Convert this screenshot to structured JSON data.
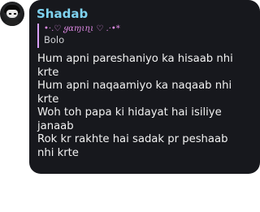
{
  "message": {
    "sender": "Shadab",
    "reply": {
      "author": "•·.♡ ყαɱιɳι ♡ .·•*",
      "text": "Bolo"
    },
    "lines": [
      "Hum apni pareshaniyo ka hisaab nhi",
      "krte",
      "Hum apni naqaamiyo ka naqaab nhi",
      "krte",
      "Woh toh papa ki hidayat hai isiliye",
      "janaab",
      "Rok kr rakhte hai sadak pr peshaab",
      "nhi krte"
    ]
  },
  "colors": {
    "bubble_background": "#17181d",
    "sender_name": "#7fd3f0",
    "reply_bar": "#d9a0ff",
    "reply_author": "#e08ae6",
    "message_text": "#f2f2f2"
  },
  "icons": {
    "avatar": "user-avatar-icon"
  }
}
